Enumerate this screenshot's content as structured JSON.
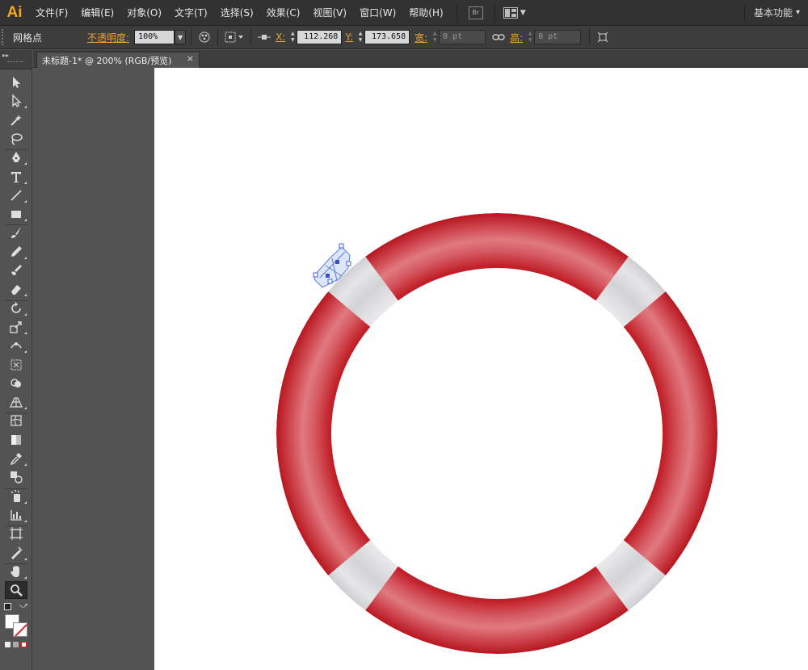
{
  "app": {
    "logo": "Ai"
  },
  "menu": {
    "items": [
      {
        "label": "文件(F)"
      },
      {
        "label": "编辑(E)"
      },
      {
        "label": "对象(O)"
      },
      {
        "label": "文字(T)"
      },
      {
        "label": "选择(S)"
      },
      {
        "label": "效果(C)"
      },
      {
        "label": "视图(V)"
      },
      {
        "label": "窗口(W)"
      },
      {
        "label": "帮助(H)"
      }
    ],
    "bridge_icon": "Br",
    "workspace": "基本功能",
    "workspace_arrow": "▾"
  },
  "control_bar": {
    "selection_type": "网格点",
    "opacity_label": "不透明度:",
    "opacity_value": "100%",
    "x_label": "X:",
    "x_value": "112.268",
    "y_label": "Y:",
    "y_value": "173.658",
    "width_label": "宽:",
    "width_value": "0 pt",
    "height_label": "高:",
    "height_value": "0 pt"
  },
  "document": {
    "tab_title": "未标题-1* @ 200% (RGB/预览)",
    "close_glyph": "×"
  },
  "toolbar": {
    "collapse_glyph": "▸▸",
    "tools": [
      "selection-tool",
      "direct-selection-tool",
      "magic-wand-tool",
      "lasso-tool",
      "pen-tool",
      "type-tool",
      "line-segment-tool",
      "rectangle-tool",
      "paintbrush-tool",
      "pencil-tool",
      "blob-brush-tool",
      "eraser-tool",
      "rotate-tool",
      "scale-tool",
      "width-tool",
      "free-transform-tool",
      "shape-builder-tool",
      "perspective-grid-tool",
      "mesh-tool",
      "gradient-tool",
      "eyedropper-tool",
      "blend-tool",
      "symbol-sprayer-tool",
      "column-graph-tool",
      "artboard-tool",
      "slice-tool",
      "hand-tool",
      "zoom-tool"
    ],
    "active_tool": "zoom-tool"
  },
  "colors": {
    "accent": "#f7a51c",
    "ring_red": "#c4262e",
    "ring_highlight": "#e88d92",
    "band_gray": "#d8d8d8",
    "artboard": "#ffffff",
    "ui_dark": "#323232",
    "ui_mid": "#535353"
  }
}
